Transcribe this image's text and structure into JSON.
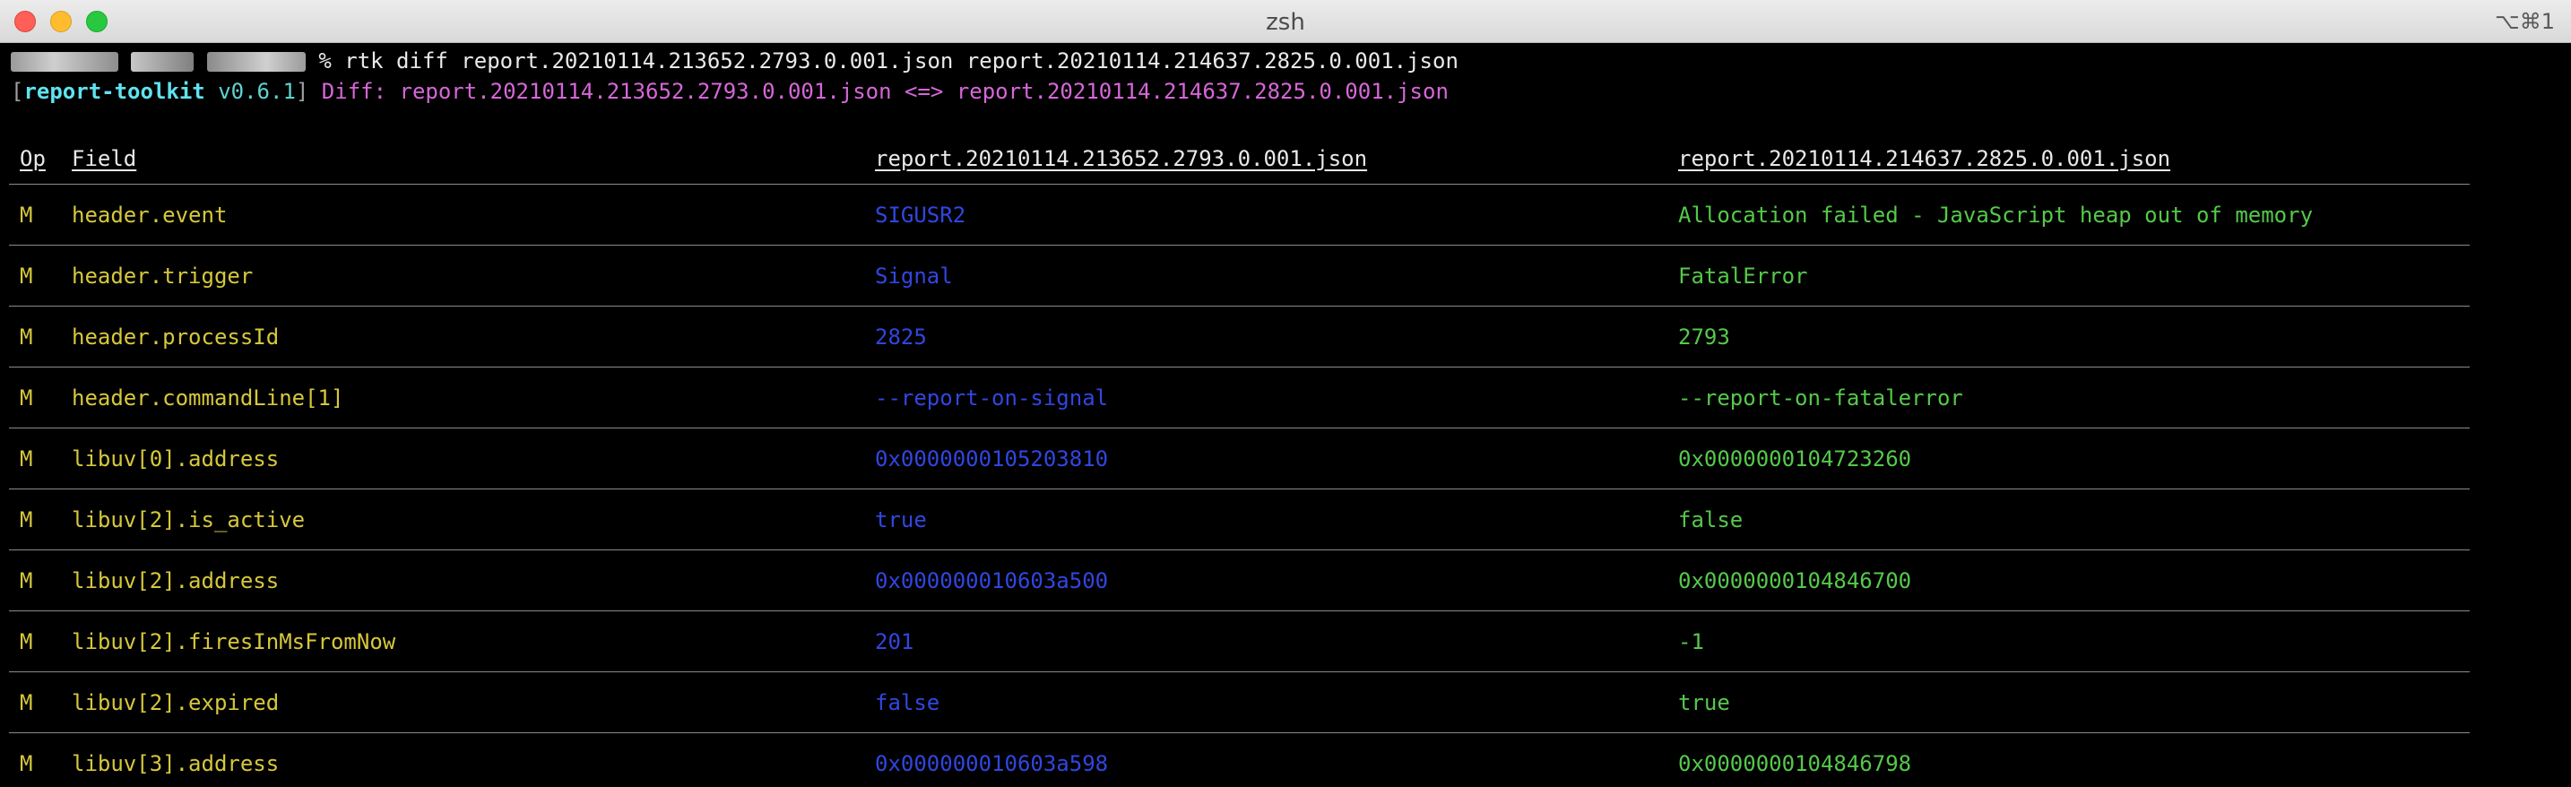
{
  "window": {
    "title": "zsh",
    "shortcut": "⌥⌘1"
  },
  "command": {
    "text": "% rtk diff report.20210114.213652.2793.0.001.json report.20210114.214637.2825.0.001.json"
  },
  "banner": {
    "open_bracket": "[",
    "tool_name": "report-toolkit",
    "version": " v0.6.1",
    "close_bracket": "]",
    "diff_text": " Diff: report.20210114.213652.2793.0.001.json <=> report.20210114.214637.2825.0.001.json"
  },
  "table": {
    "headers": {
      "op": "Op",
      "field": "Field",
      "left": "report.20210114.213652.2793.0.001.json",
      "right": "report.20210114.214637.2825.0.001.json"
    },
    "rows": [
      {
        "op": "M",
        "field": "header.event",
        "left": "SIGUSR2",
        "right": "Allocation failed - JavaScript heap out of memory"
      },
      {
        "op": "M",
        "field": "header.trigger",
        "left": "Signal",
        "right": "FatalError"
      },
      {
        "op": "M",
        "field": "header.processId",
        "left": "2825",
        "right": "2793"
      },
      {
        "op": "M",
        "field": "header.commandLine[1]",
        "left": "--report-on-signal",
        "right": "--report-on-fatalerror"
      },
      {
        "op": "M",
        "field": "libuv[0].address",
        "left": "0x0000000105203810",
        "right": "0x0000000104723260"
      },
      {
        "op": "M",
        "field": "libuv[2].is_active",
        "left": "true",
        "right": "false"
      },
      {
        "op": "M",
        "field": "libuv[2].address",
        "left": "0x000000010603a500",
        "right": "0x0000000104846700"
      },
      {
        "op": "M",
        "field": "libuv[2].firesInMsFromNow",
        "left": "201",
        "right": "-1"
      },
      {
        "op": "M",
        "field": "libuv[2].expired",
        "left": "false",
        "right": "true"
      },
      {
        "op": "M",
        "field": "libuv[3].address",
        "left": "0x000000010603a598",
        "right": "0x0000000104846798"
      }
    ]
  },
  "colors": {
    "op": "#d6c83b",
    "field": "#d6c83b",
    "left_value": "#3146e0",
    "right_value": "#55c94a",
    "tool_name": "#5fe3ef",
    "diff_text": "#d667d8"
  }
}
